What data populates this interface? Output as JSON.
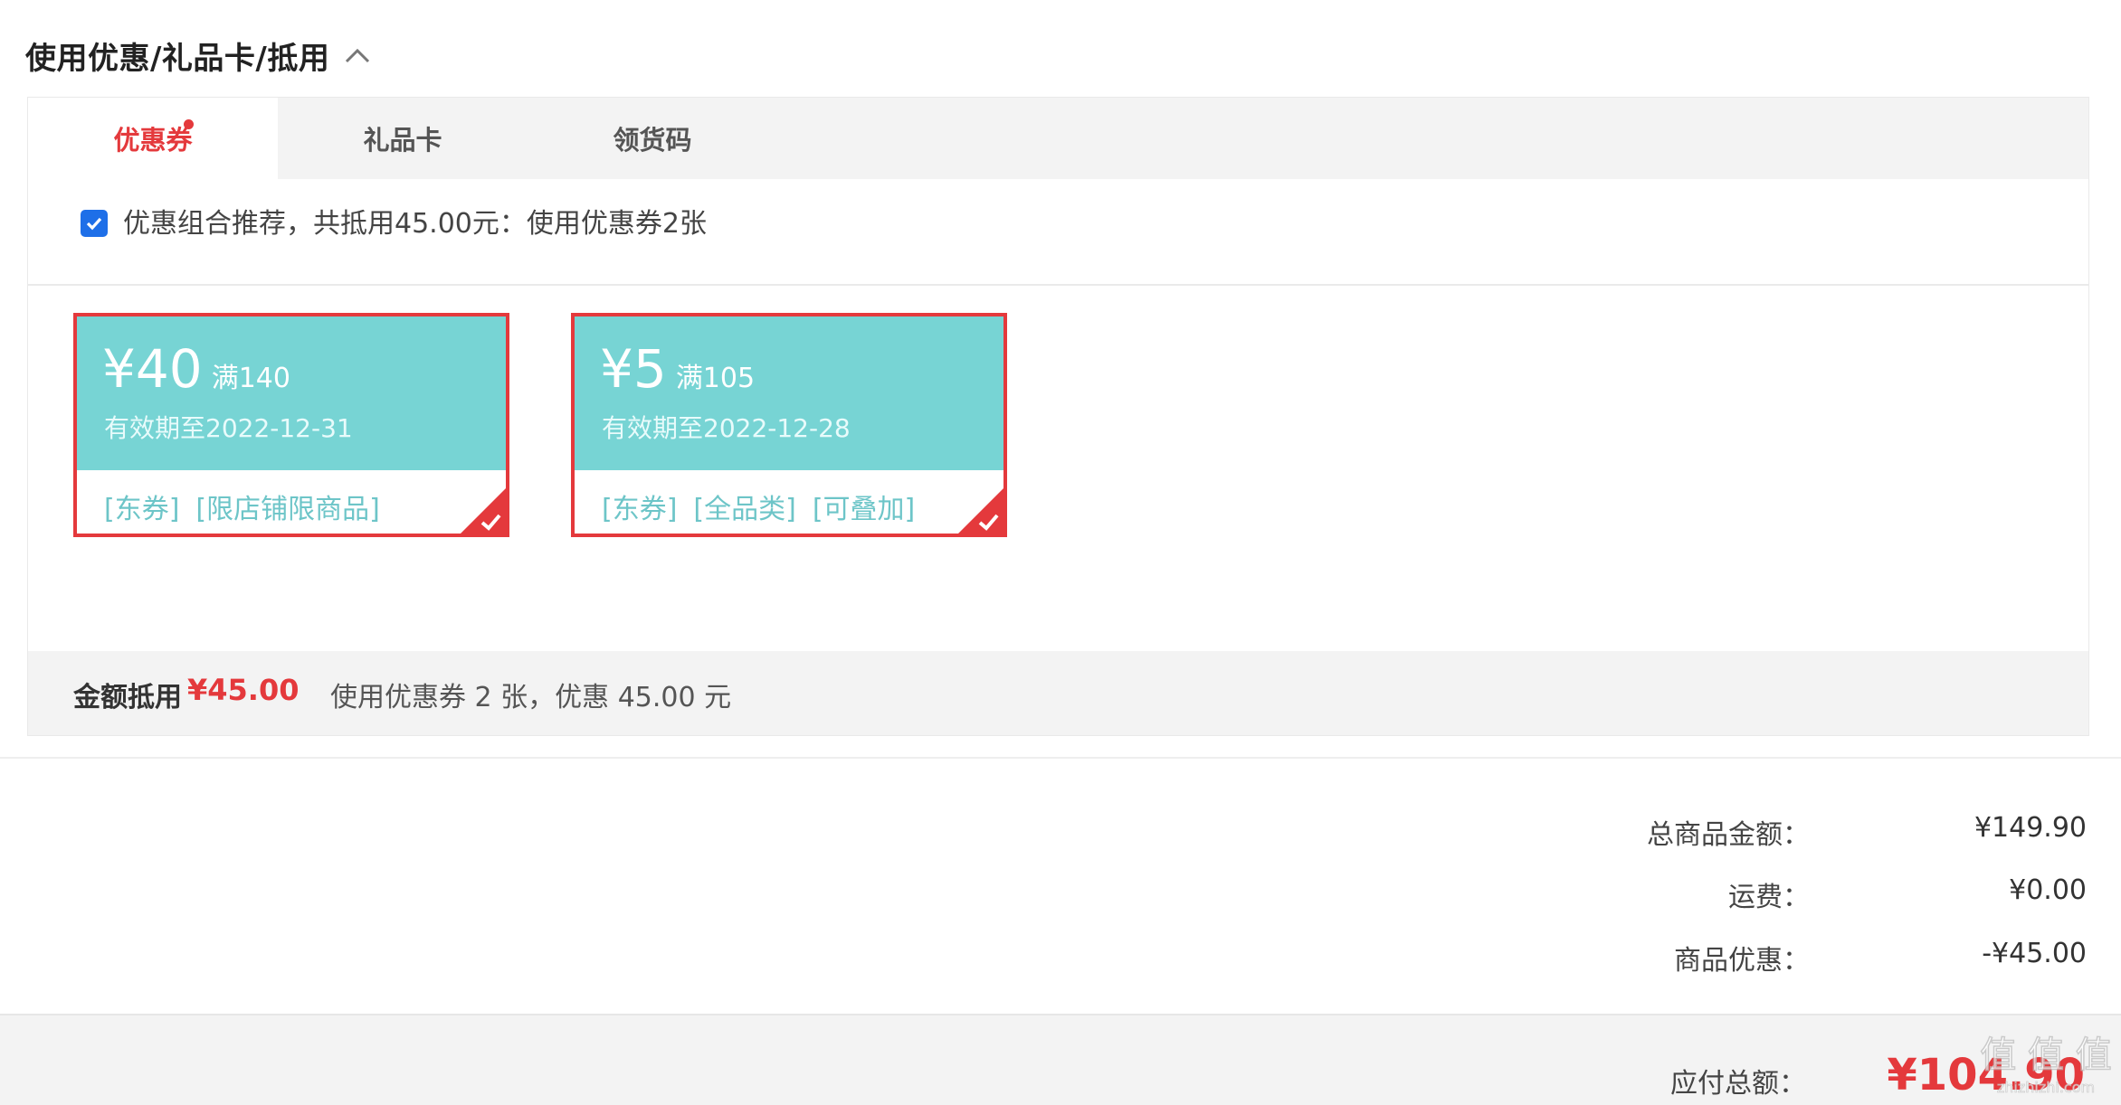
{
  "section": {
    "title": "使用优惠/礼品卡/抵用"
  },
  "tabs": [
    {
      "label": "优惠券",
      "active": true,
      "has_dot": true
    },
    {
      "label": "礼品卡",
      "active": false
    },
    {
      "label": "领货码",
      "active": false
    }
  ],
  "combo": {
    "checked": true,
    "text": "优惠组合推荐，共抵用45.00元：使用优惠券2张"
  },
  "coupons": [
    {
      "currency": "¥",
      "amount": "40",
      "condition": "满140",
      "valid": "有效期至2022-12-31",
      "tags": [
        "[东券]",
        "[限店铺限商品]"
      ],
      "selected": true
    },
    {
      "currency": "¥",
      "amount": "5",
      "condition": "满105",
      "valid": "有效期至2022-12-28",
      "tags": [
        "[东券]",
        "[全品类]",
        "[可叠加]"
      ],
      "selected": true
    }
  ],
  "summary": {
    "label": "金额抵用",
    "amount": "¥45.00",
    "desc": "使用优惠券 2 张，优惠 45.00 元"
  },
  "totals": [
    {
      "label": "总商品金额：",
      "value": "¥149.90"
    },
    {
      "label": "运费：",
      "value": "¥0.00"
    },
    {
      "label": "商品优惠：",
      "value": "-¥45.00"
    }
  ],
  "payable": {
    "label": "应付总额：",
    "value": "¥104.90"
  },
  "watermark": {
    "text": "值 值 值",
    "subtext": "zhizhizhi.com"
  },
  "colors": {
    "accent": "#e4393c",
    "coupon_bg": "#77d4d4",
    "tag_text": "#6dc5c8",
    "checkbox": "#1e6fe8"
  }
}
